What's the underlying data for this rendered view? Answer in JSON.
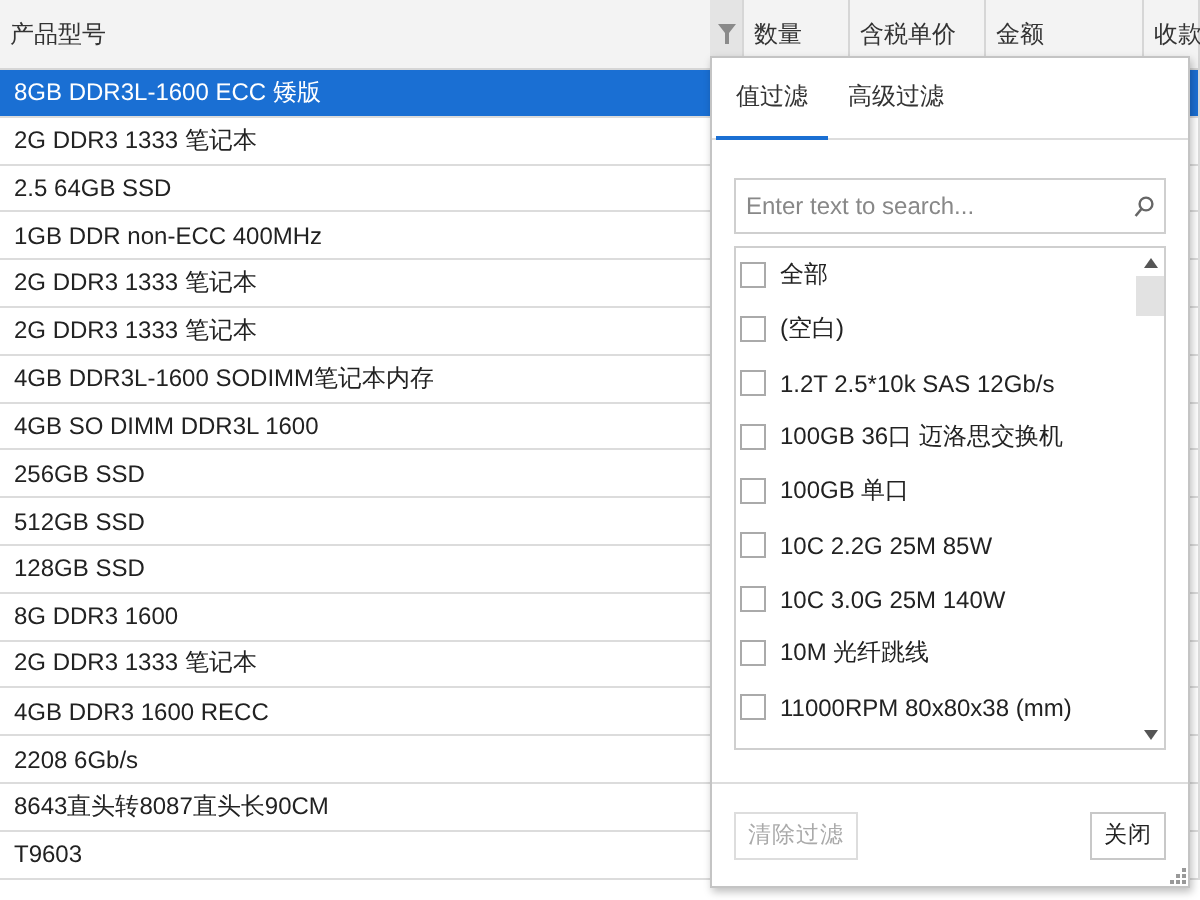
{
  "table": {
    "columns": [
      "产品型号",
      "数量",
      "含税单价",
      "金额",
      "收款"
    ],
    "rows": [
      {
        "cells": [
          "8GB DDR3L-1600 ECC 矮版"
        ],
        "selected": true
      },
      {
        "cells": [
          "2G DDR3 1333 笔记本"
        ],
        "selected": false
      },
      {
        "cells": [
          "2.5 64GB  SSD"
        ],
        "selected": false
      },
      {
        "cells": [
          "1GB DDR non-ECC 400MHz"
        ],
        "selected": false
      },
      {
        "cells": [
          "2G DDR3 1333 笔记本"
        ],
        "selected": false
      },
      {
        "cells": [
          "2G DDR3 1333 笔记本"
        ],
        "selected": false
      },
      {
        "cells": [
          "4GB DDR3L-1600 SODIMM笔记本内存"
        ],
        "selected": false
      },
      {
        "cells": [
          "4GB SO DIMM DDR3L 1600"
        ],
        "selected": false
      },
      {
        "cells": [
          "256GB  SSD"
        ],
        "selected": false
      },
      {
        "cells": [
          "512GB  SSD"
        ],
        "selected": false
      },
      {
        "cells": [
          "128GB  SSD"
        ],
        "selected": false
      },
      {
        "cells": [
          "8G DDR3 1600"
        ],
        "selected": false
      },
      {
        "cells": [
          "2G DDR3 1333 笔记本"
        ],
        "selected": false
      },
      {
        "cells": [
          "4GB DDR3 1600 RECC"
        ],
        "selected": false
      },
      {
        "cells": [
          "2208 6Gb/s"
        ],
        "selected": false
      },
      {
        "cells": [
          "8643直头转8087直头长90CM"
        ],
        "selected": false
      },
      {
        "cells": [
          "T9603"
        ],
        "selected": false
      }
    ]
  },
  "filter_popup": {
    "tabs": [
      {
        "label": "值过滤",
        "selected": true
      },
      {
        "label": "高级过滤",
        "selected": false
      }
    ],
    "search": {
      "placeholder": "Enter text to search..."
    },
    "values": [
      {
        "label": "全部",
        "checked": false
      },
      {
        "label": "(空白)",
        "checked": false
      },
      {
        "label": "1.2T 2.5*10k SAS 12Gb/s",
        "checked": false
      },
      {
        "label": "100GB  36口 迈洛思交换机",
        "checked": false
      },
      {
        "label": "100GB  单口",
        "checked": false
      },
      {
        "label": "10C 2.2G 25M 85W",
        "checked": false
      },
      {
        "label": "10C 3.0G 25M 140W",
        "checked": false
      },
      {
        "label": "10M 光纤跳线",
        "checked": false
      },
      {
        "label": "11000RPM 80x80x38 (mm)",
        "checked": false
      }
    ],
    "buttons": [
      {
        "label": "清除过滤",
        "disabled": true
      },
      {
        "label": "关闭",
        "disabled": false
      }
    ]
  }
}
